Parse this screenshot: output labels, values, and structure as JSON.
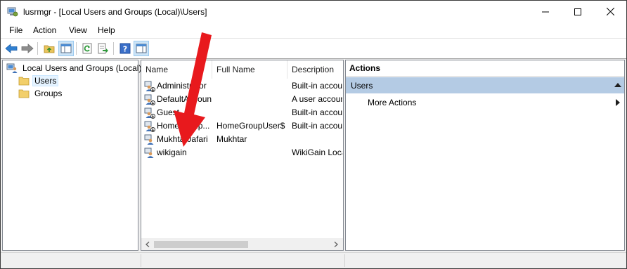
{
  "window": {
    "title": "lusrmgr - [Local Users and Groups (Local)\\Users]",
    "app_icon": "computer-management-icon"
  },
  "menu": [
    "File",
    "Action",
    "View",
    "Help"
  ],
  "toolbar": {
    "buttons": [
      "back-icon",
      "forward-icon",
      "up-folder-icon",
      "show-hide-tree-icon",
      "refresh-icon",
      "export-list-icon",
      "help-icon",
      "show-hide-action-pane-icon"
    ]
  },
  "tree": {
    "root": "Local Users and Groups (Local)",
    "items": [
      "Users",
      "Groups"
    ],
    "selected": "Users"
  },
  "list": {
    "columns": [
      "Name",
      "Full Name",
      "Description"
    ],
    "rows": [
      {
        "name": "Administrator",
        "full_name": "",
        "description": "Built-in account for administering the computer/domain"
      },
      {
        "name": "DefaultAccount",
        "full_name": "",
        "description": "A user account managed by the system."
      },
      {
        "name": "Guest",
        "full_name": "",
        "description": "Built-in account for guest access to the computer/domain"
      },
      {
        "name": "HomeGroup...",
        "full_name": "HomeGroupUser$",
        "description": "Built-in account for homegroup access to the computer"
      },
      {
        "name": "MukhtarJafari",
        "full_name": "Mukhtar",
        "description": ""
      },
      {
        "name": "wikigain",
        "full_name": "",
        "description": "WikiGain Local"
      }
    ]
  },
  "actions": {
    "title": "Actions",
    "group": "Users",
    "items": [
      "More Actions"
    ]
  },
  "annotation": {
    "color": "#e8191d",
    "icon": "red-arrow-pointer"
  }
}
